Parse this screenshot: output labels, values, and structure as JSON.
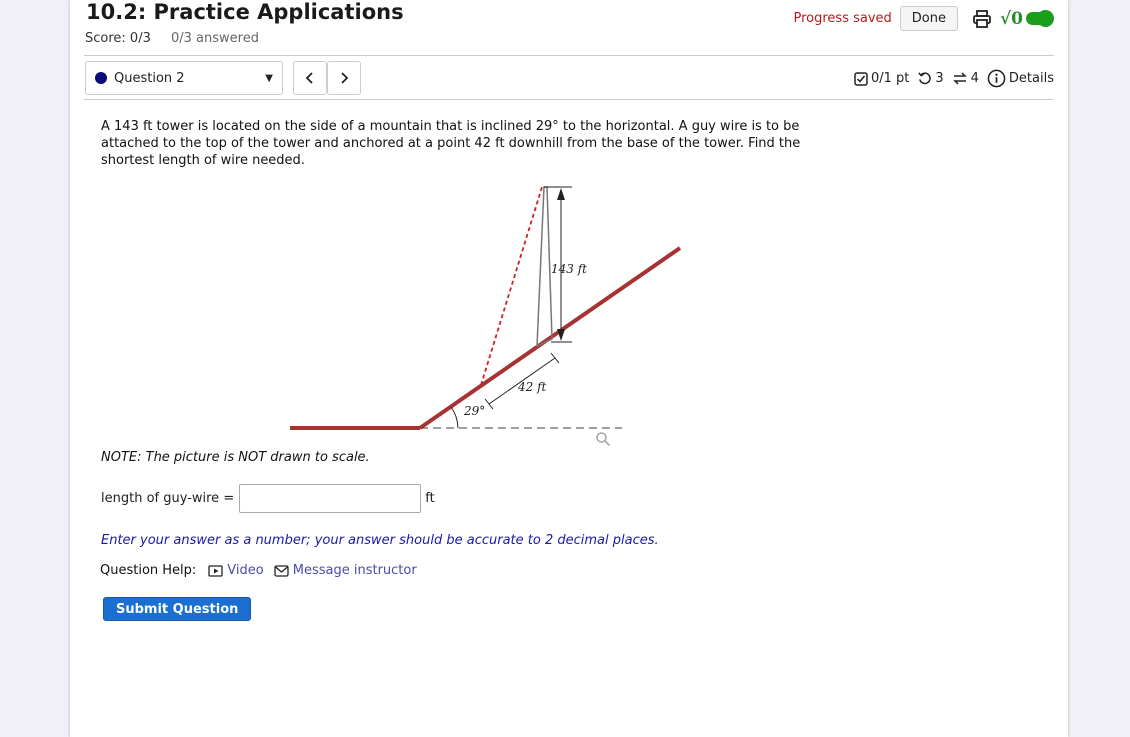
{
  "header": {
    "title": "10.2: Practice Applications",
    "score": "Score: 0/3",
    "answered": "0/3 answered",
    "progress_saved": "Progress saved",
    "done_label": "Done",
    "sqrt_label": "√0"
  },
  "question_nav": {
    "selected": "Question 2",
    "prev_label": "<",
    "next_label": ">"
  },
  "question_meta": {
    "points": "0/1 pt",
    "retries": "3",
    "attempts": "4",
    "details": "Details"
  },
  "question": {
    "text": "A 143 ft tower is located on the side of a mountain that is inclined 29° to the horizontal. A guy wire is to be attached to the top of the tower and anchored at a point 42 ft downhill from the base of the tower. Find the shortest length of wire needed.",
    "diagram": {
      "tower_label": "143 ft",
      "distance_label": "42 ft",
      "angle_label": "29°"
    },
    "note": "NOTE: The picture is NOT drawn to scale."
  },
  "answer": {
    "label": "length of guy-wire =",
    "value": "",
    "unit": "ft"
  },
  "hint": "Enter your answer as a number; your answer should be accurate to 2 decimal places.",
  "help": {
    "label": "Question Help:",
    "video": "Video",
    "message": "Message instructor"
  },
  "submit_label": "Submit Question",
  "colors": {
    "progress_saved": "#b31b1b",
    "link": "#4a4aa8",
    "hint": "#1a1aa8",
    "submit": "#1b6fd1",
    "mountain": "#a83232",
    "toggle": "#1a9d1a"
  }
}
